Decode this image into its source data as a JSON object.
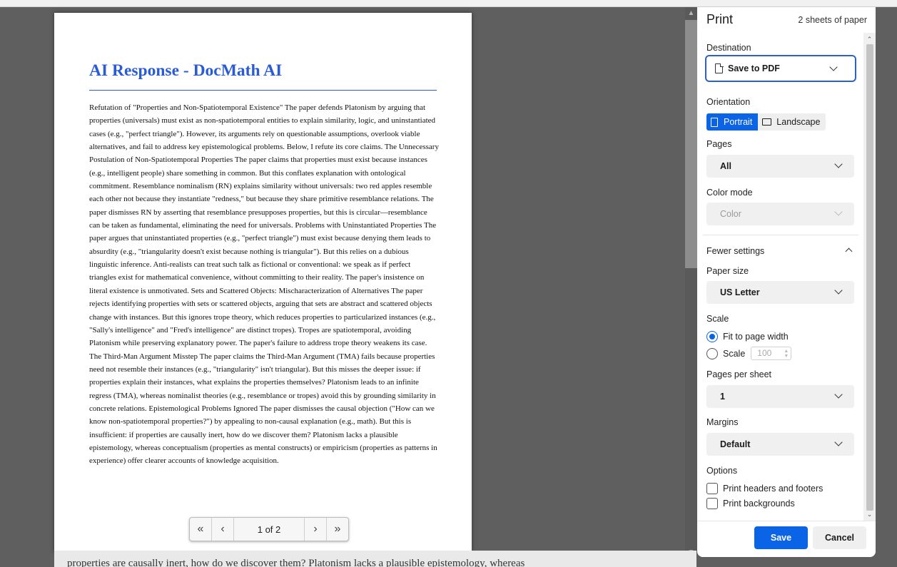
{
  "preview": {
    "document_title": "AI Response - DocMath AI",
    "document_body": "Refutation of \"Properties and Non-Spatiotemporal Existence\" The paper defends Platonism by arguing that properties (universals) must exist as non-spatiotemporal entities to explain similarity, logic, and uninstantiated cases (e.g., \"perfect triangle\"). However, its arguments rely on questionable assumptions, overlook viable alternatives, and fail to address key epistemological problems. Below, I refute its core claims. The Unnecessary Postulation of Non-Spatiotemporal Properties The paper claims that properties must exist because instances (e.g., intelligent people) share something in common. But this conflates explanation with ontological commitment. Resemblance nominalism (RN) explains similarity without universals: two red apples resemble each other not because they instantiate \"redness,\" but because they share primitive resemblance relations. The paper dismisses RN by asserting that resemblance presupposes properties, but this is circular—resemblance can be taken as fundamental, eliminating the need for universals. Problems with Uninstantiated Properties The paper argues that uninstantiated properties (e.g., \"perfect triangle\") must exist because denying them leads to absurdity (e.g., \"triangularity doesn't exist because nothing is triangular\"). But this relies on a dubious linguistic inference. Anti-realists can treat such talk as fictional or conventional: we speak as if perfect triangles exist for mathematical convenience, without committing to their reality. The paper's insistence on literal existence is unmotivated. Sets and Scattered Objects: Mischaracterization of Alternatives The paper rejects identifying properties with sets or scattered objects, arguing that sets are abstract and scattered objects change with instances. But this ignores trope theory, which reduces properties to particularized instances (e.g., \"Sally's intelligence\" and \"Fred's intelligence\" are distinct tropes). Tropes are spatiotemporal, avoiding Platonism while preserving explanatory power. The paper's failure to address trope theory weakens its case. The Third-Man Argument Misstep The paper claims the Third-Man Argument (TMA) fails because properties need not resemble their instances (e.g., \"triangularity\" isn't triangular). But this misses the deeper issue: if properties explain their instances, what explains the properties themselves? Platonism leads to an infinite regress (TMA), whereas nominalist theories (e.g., resemblance or tropes) avoid this by grounding similarity in concrete relations. Epistemological Problems Ignored The paper dismisses the causal objection (\"How can we know non-spatiotemporal properties?\") by appealing to non-causal explanation (e.g., math). But this is insufficient: if properties are causally inert, how do we discover them? Platonism lacks a plausible epistemology, whereas conceptualism (properties as mental constructs) or empiricism (properties as patterns in experience) offer clearer accounts of knowledge acquisition.",
    "page_counter": "1 of 2",
    "nav_first_icon": "«",
    "nav_prev_icon": "‹",
    "nav_next_icon": "›",
    "nav_last_icon": "»"
  },
  "behind_page": {
    "text": "properties are causally inert, how do we discover them? Platonism lacks a plausible epistemology, whereas"
  },
  "panel": {
    "title": "Print",
    "sheets": "2 sheets of paper",
    "destination": {
      "label": "Destination",
      "value": "Save to PDF",
      "icon": "document-icon"
    },
    "orientation": {
      "label": "Orientation",
      "portrait": "Portrait",
      "landscape": "Landscape",
      "selected": "Portrait"
    },
    "pages": {
      "label": "Pages",
      "value": "All"
    },
    "color_mode": {
      "label": "Color mode",
      "value": "Color",
      "enabled": false
    },
    "fewer_settings": "Fewer settings",
    "paper_size": {
      "label": "Paper size",
      "value": "US Letter"
    },
    "scale": {
      "label": "Scale",
      "fit_option": "Fit to page width",
      "custom_option": "Scale",
      "custom_value": "100",
      "selected": "Fit to page width"
    },
    "pages_per_sheet": {
      "label": "Pages per sheet",
      "value": "1"
    },
    "margins": {
      "label": "Margins",
      "value": "Default"
    },
    "options": {
      "label": "Options",
      "headers_footers": "Print headers and footers",
      "backgrounds": "Print backgrounds",
      "headers_checked": false,
      "backgrounds_checked": false
    },
    "save_label": "Save",
    "cancel_label": "Cancel"
  },
  "colors": {
    "accent": "#0b63e5",
    "title_blue": "#2a5bd7",
    "preview_background": "#5f5f5f"
  }
}
